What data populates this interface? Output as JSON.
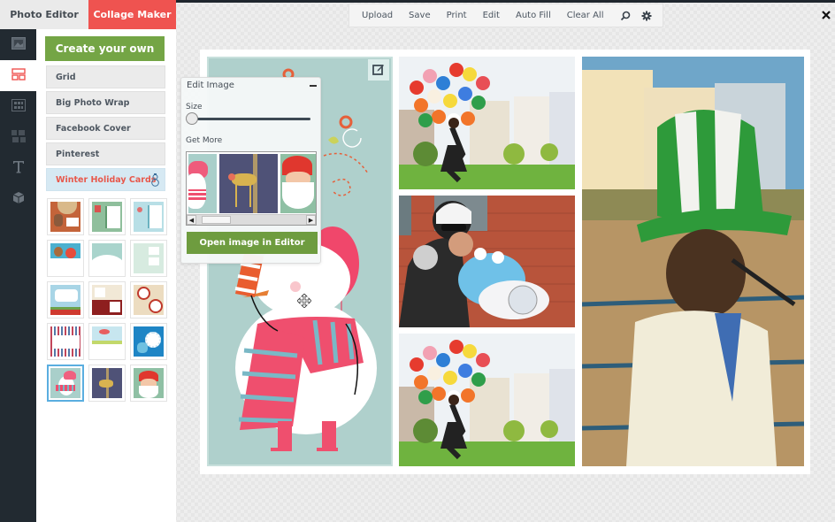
{
  "mode_tabs": [
    {
      "label": "Photo Editor",
      "active": false
    },
    {
      "label": "Collage Maker",
      "active": true
    }
  ],
  "toolbar": {
    "buttons": [
      "Upload",
      "Save",
      "Print",
      "Edit",
      "Auto Fill",
      "Clear All"
    ],
    "icons": [
      "search-icon",
      "gear-icon"
    ]
  },
  "rail": {
    "items": [
      {
        "icon": "photo-icon",
        "active": false
      },
      {
        "icon": "layout-icon",
        "active": true
      },
      {
        "icon": "grid-icon",
        "active": false
      },
      {
        "icon": "pattern-icon",
        "active": false
      },
      {
        "icon": "text-icon",
        "active": false
      },
      {
        "icon": "sticker-box-icon",
        "active": false
      }
    ]
  },
  "panel": {
    "create_label": "Create your own",
    "categories": [
      "Grid",
      "Big Photo Wrap",
      "Facebook Cover",
      "Pinterest",
      "Winter Holiday Cards"
    ],
    "active_category": "Winter Holiday Cards",
    "templates": [
      "gingerbread",
      "stockings",
      "ornaments",
      "reindeer-santa",
      "snow-hill-deer",
      "winter-tree",
      "snowflake-frame",
      "ornament-card",
      "deer-circles",
      "sweater-pattern",
      "birds-bunting",
      "blue-reindeer",
      "snowman",
      "gold-reindeer",
      "santa"
    ],
    "selected_template": "snowman"
  },
  "popup": {
    "title": "Edit Image",
    "size_label": "Size",
    "size_value": 0.02,
    "get_more_label": "Get More",
    "open_editor_label": "Open image in Editor"
  },
  "colors": {
    "accent_red": "#ef5350",
    "accent_green": "#74a545",
    "rail_dark": "#222a31",
    "selected_blue": "#5aaee0"
  }
}
